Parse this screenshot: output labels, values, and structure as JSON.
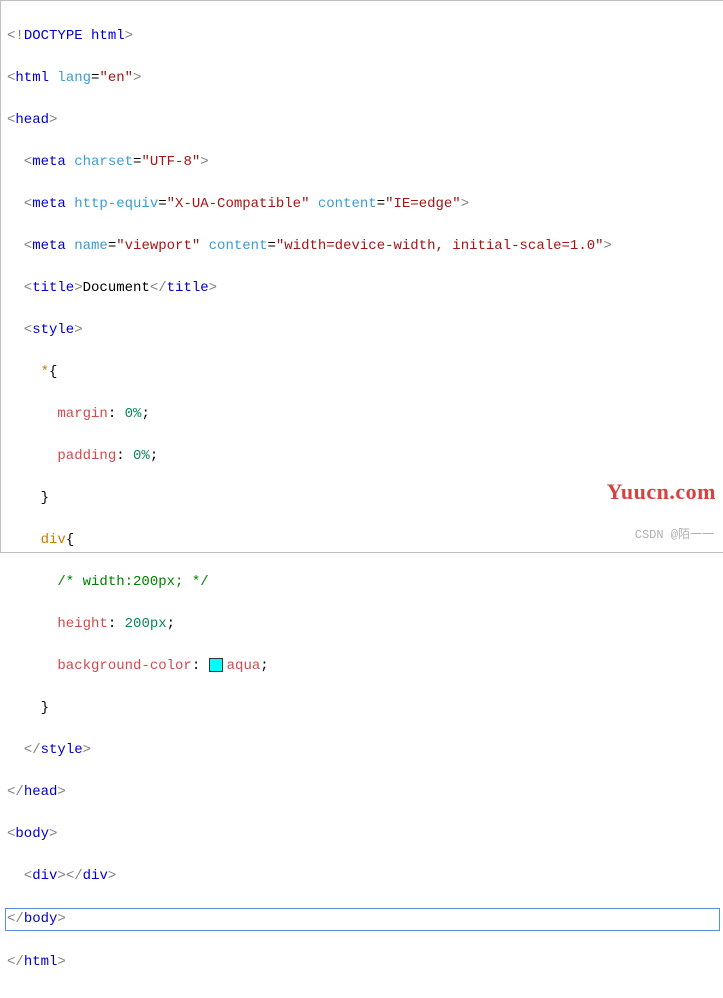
{
  "doctype": {
    "lt": "<!",
    "name": "DOCTYPE",
    "arg": "html",
    "gt": ">"
  },
  "html_open": {
    "lt": "<",
    "name": "html",
    "attr1": "lang",
    "eq": "=",
    "val1": "\"en\"",
    "gt": ">"
  },
  "head_open": {
    "lt": "<",
    "name": "head",
    "gt": ">"
  },
  "meta1": {
    "lt": "<",
    "name": "meta",
    "a1": "charset",
    "eq": "=",
    "v1": "\"UTF-8\"",
    "gt": ">"
  },
  "meta2": {
    "lt": "<",
    "name": "meta",
    "a1": "http-equiv",
    "v1": "\"X-UA-Compatible\"",
    "a2": "content",
    "v2": "\"IE=edge\"",
    "gt": ">"
  },
  "meta3": {
    "lt": "<",
    "name": "meta",
    "a1": "name",
    "v1": "\"viewport\"",
    "a2": "content",
    "v2": "\"width=device-width, initial-scale=1.0\"",
    "gt": ">"
  },
  "title": {
    "open_lt": "<",
    "open_name": "title",
    "open_gt": ">",
    "text": "Document",
    "close": "</title>"
  },
  "style_open": {
    "lt": "<",
    "name": "style",
    "gt": ">"
  },
  "rule1": {
    "sel": "*",
    "ob": "{",
    "p1": "margin",
    "v1": "0%",
    "p2": "padding",
    "v2": "0%",
    "cb": "}"
  },
  "rule2": {
    "sel": "div",
    "ob": "{",
    "c1": "/* width:200px; */",
    "p1": "height",
    "v1": "200px",
    "p2": "background-color",
    "v2": "aqua",
    "cb": "}"
  },
  "style_close": "</style>",
  "head_close": "</head>",
  "body_open": {
    "lt": "<",
    "name": "body",
    "gt": ">"
  },
  "div_line": {
    "open": "<div>",
    "close": "</div>"
  },
  "body_close": "</body>",
  "html_close": "</html>",
  "watermark": "Yuucn.com",
  "csdn": "CSDN @陌一一",
  "colon": ":",
  "semi": ";",
  "sp": " ",
  "eq": "="
}
